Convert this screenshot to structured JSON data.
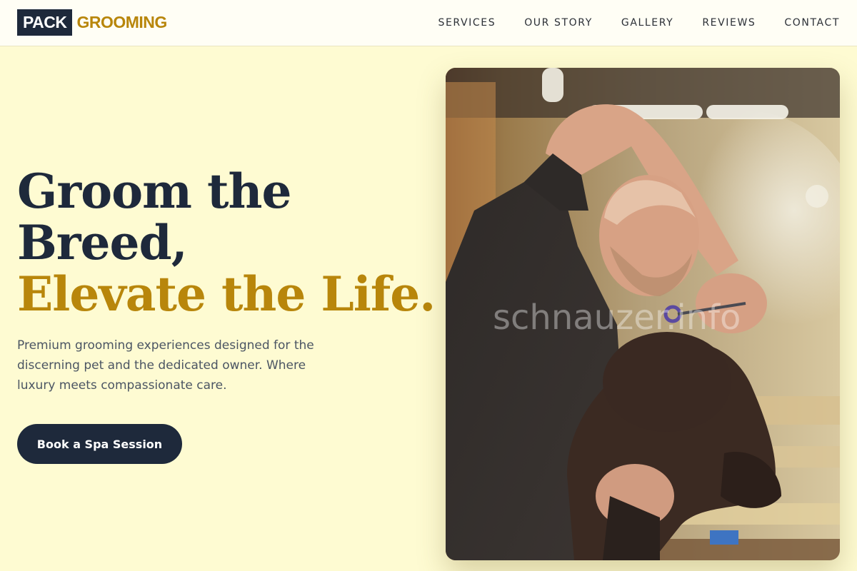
{
  "header": {
    "logo": {
      "part1": "PACK",
      "part2": "GROOMING"
    },
    "nav": [
      {
        "label": "SERVICES"
      },
      {
        "label": "OUR STORY"
      },
      {
        "label": "GALLERY"
      },
      {
        "label": "REVIEWS"
      },
      {
        "label": "CONTACT"
      }
    ]
  },
  "hero": {
    "headline": {
      "line1": "Groom the",
      "line2": "Breed,",
      "line3": "Elevate the Life."
    },
    "subtitle": "Premium grooming experiences designed for the discerning pet and the dedicated owner. Where luxury meets compassionate care.",
    "cta_label": "Book a Spa Session",
    "image": {
      "alt": "Groomer trimming a dark dog's fur with scissors",
      "watermark": "schnauzer.info"
    }
  },
  "colors": {
    "background": "#fefbd2",
    "header_bg": "#fffef5",
    "navy": "#1e293b",
    "gold": "#b8860b",
    "body_text": "#4b5563"
  }
}
